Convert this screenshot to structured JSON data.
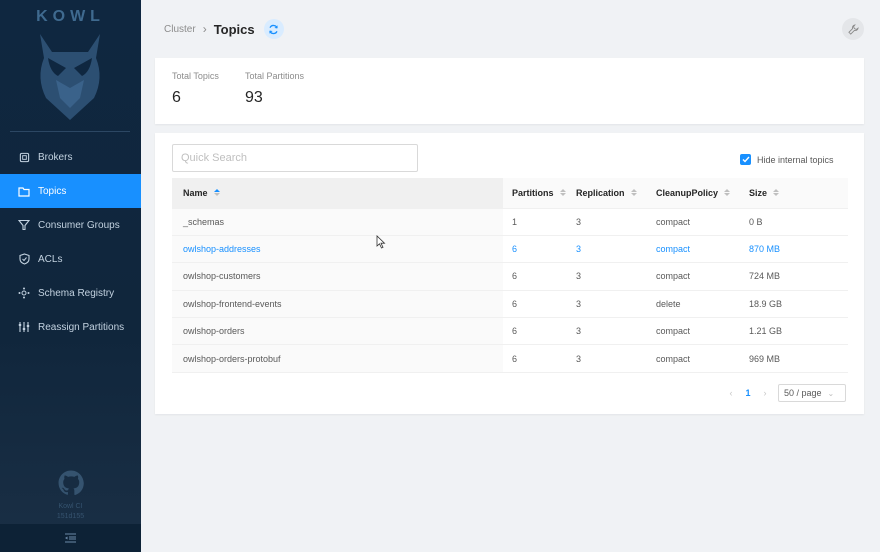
{
  "sidebar": {
    "logo_text": "KOWL",
    "items": [
      {
        "label": "Brokers",
        "icon": "brokers-icon",
        "active": false
      },
      {
        "label": "Topics",
        "icon": "topics-icon",
        "active": true
      },
      {
        "label": "Consumer Groups",
        "icon": "consumer-groups-icon",
        "active": false
      },
      {
        "label": "ACLs",
        "icon": "shield-icon",
        "active": false
      },
      {
        "label": "Schema Registry",
        "icon": "schema-registry-icon",
        "active": false
      },
      {
        "label": "Reassign Partitions",
        "icon": "reassign-partitions-icon",
        "active": false
      }
    ],
    "footer": {
      "product": "Kowl CI",
      "version": "151d155"
    }
  },
  "header": {
    "breadcrumb_root": "Cluster",
    "breadcrumb_sep": "›",
    "title": "Topics"
  },
  "stats": {
    "total_topics_label": "Total Topics",
    "total_topics_value": "6",
    "total_partitions_label": "Total Partitions",
    "total_partitions_value": "93"
  },
  "topics": {
    "search_placeholder": "Quick Search",
    "hide_internal_label": "Hide internal topics",
    "hide_internal_checked": true,
    "columns": [
      "Name",
      "Partitions",
      "Replication",
      "CleanupPolicy",
      "Size"
    ],
    "rows": [
      {
        "name": "_schemas",
        "partitions": "1",
        "replication": "3",
        "cleanup": "compact",
        "size": "0 B"
      },
      {
        "name": "owlshop-addresses",
        "partitions": "6",
        "replication": "3",
        "cleanup": "compact",
        "size": "870 MB"
      },
      {
        "name": "owlshop-customers",
        "partitions": "6",
        "replication": "3",
        "cleanup": "compact",
        "size": "724 MB"
      },
      {
        "name": "owlshop-frontend-events",
        "partitions": "6",
        "replication": "3",
        "cleanup": "delete",
        "size": "18.9 GB"
      },
      {
        "name": "owlshop-orders",
        "partitions": "6",
        "replication": "3",
        "cleanup": "compact",
        "size": "1.21 GB"
      },
      {
        "name": "owlshop-orders-protobuf",
        "partitions": "6",
        "replication": "3",
        "cleanup": "compact",
        "size": "969 MB"
      }
    ],
    "highlighted_row": 1
  },
  "pagination": {
    "prev": "‹",
    "current_page": "1",
    "next": "›",
    "page_size": "50 / page"
  },
  "colors": {
    "accent": "#1890ff",
    "sidebar_bg": "#10263c"
  }
}
